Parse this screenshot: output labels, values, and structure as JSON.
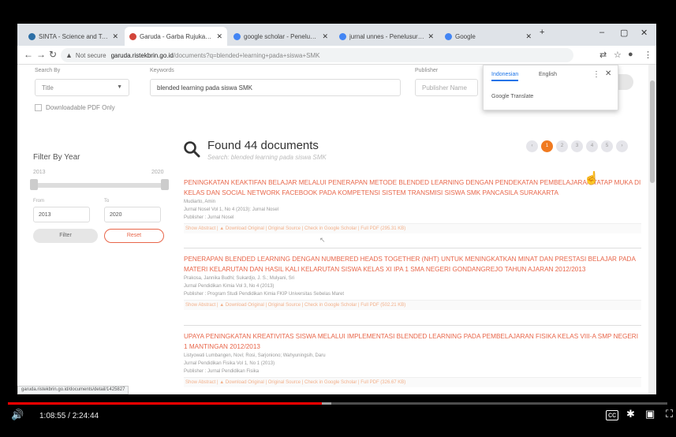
{
  "browser": {
    "tabs": [
      {
        "label": "SINTA - Science and Technolo",
        "fav": "#2b6ea6",
        "active": false
      },
      {
        "label": "Garuda - Garba Rujukan Digit",
        "fav": "#d2453a",
        "active": true
      },
      {
        "label": "google scholar - Penelusuran",
        "fav": "#4285f4",
        "active": false
      },
      {
        "label": "jurnal unnes - Penelusuran G",
        "fav": "#4285f4",
        "active": false
      },
      {
        "label": "Google",
        "fav": "#4285f4",
        "active": false
      }
    ],
    "address": {
      "not_secure": "Not secure",
      "host": "garuda.ristekbrin.go.id",
      "path": "/documents?q=blended+learning+pada+siswa+SMK"
    },
    "status_url": "garuda.ristekbrin.go.id/documents/detail/1425827"
  },
  "search": {
    "search_by_label": "Search By",
    "keyword_label": "Keywords",
    "publisher_label": "Publisher",
    "field_value": "Title",
    "keyword_value": "blended learning pada siswa SMK",
    "publisher_placeholder": "Publisher Name",
    "downloadable_label": "Downloadable PDF Only"
  },
  "translate": {
    "lang1": "Indonesian",
    "lang2": "English",
    "menu": "⋮",
    "close": "✕",
    "footer": "Google Translate"
  },
  "filter": {
    "title": "Filter By Year",
    "min_year": "2013",
    "max_year": "2020",
    "from_label": "From",
    "to_label": "To",
    "from_value": "2013",
    "to_value": "2020",
    "filter_btn": "Filter",
    "reset_btn": "Reset"
  },
  "results_header": {
    "found": "Found 44 documents",
    "subtitle": "Search: blended learning pada siswa SMK"
  },
  "pager": [
    "‹",
    "1",
    "2",
    "3",
    "4",
    "5",
    "›"
  ],
  "results": [
    {
      "title": "PENINGKATAN KEAKTIFAN BELAJAR MELALUI PENERAPAN METODE BLENDED LEARNING DENGAN PENDEKATAN PEMBELAJARAN TATAP MUKA DI KELAS DAN SOCIAL NETWORK FACEBOOK PADA KOMPETENSI SISTEM TRANSMISI SISWA SMK PANCASILA SURAKARTA",
      "authors": "Mudiarto, Amin",
      "journal": "Jurnal Nosel Vol 1, No 4 (2013): Jurnal Nosel",
      "publisher": "Publisher : Jurnal Nosel",
      "links": "Show Abstract | ▲ Download Original | Original Source | Check in Google Scholar | Full PDF (295.31 KB)"
    },
    {
      "title": "PENERAPAN BLENDED LEARNING DENGAN NUMBERED HEADS TOGETHER (NHT) UNTUK MENINGKATKAN MINAT DAN PRESTASI BELAJAR PADA MATERI KELARUTAN DAN HASIL KALI KELARUTAN SISWA KELAS XI IPA 1 SMA NEGERI GONDANGREJO TAHUN AJARAN 2012/2013",
      "authors": "Prakosa, Jannika Budhi; Sukardjo, J. S.; Mulyani, Sri",
      "journal": "Jurnal Pendidikan Kimia Vol 3, No 4 (2013)",
      "publisher": "Publisher : Program Studi Pendidikan Kimia FKIP Universitas Sebelas Maret",
      "links": "Show Abstract | ▲ Download Original | Original Source | Check in Google Scholar | Full PDF (502.21 KB)"
    },
    {
      "title": "UPAYA PENINGKATAN KREATIVITAS SISWA MELALUI IMPLEMENTASI BLENDED LEARNING PADA PEMBELAJARAN FISIKA KELAS VIII-A SMP NEGERI 1 MANTINGAN 2012/2013",
      "authors": "Listyowati Lumbangen, Novi; Rosi, Sarjoniono; Wahyuningsih, Daru",
      "journal": "Jurnal Pendidikan Fisika Vol 1, No 1 (2013)",
      "publisher": "Publisher : Jurnal Pendidikan Fisika",
      "links": "Show Abstract | ▲ Download Original | Original Source | Check in Google Scholar | Full PDF (326.67 KB)"
    }
  ],
  "player": {
    "time": "1:08:55 / 2:24:44",
    "played_fraction": 0.476,
    "loaded_fraction": 0.49
  },
  "colors": {
    "accent": "#e8664a",
    "page_active": "#f07a20",
    "progress": "#ff0000"
  },
  "icons": [
    "back-icon",
    "forward-icon",
    "reload-icon",
    "warning-icon",
    "translate-icon",
    "star-icon",
    "profile-icon",
    "menu-icon",
    "search-icon",
    "volume-icon",
    "captions-icon",
    "settings-icon",
    "miniplayer-icon",
    "fullscreen-icon"
  ]
}
